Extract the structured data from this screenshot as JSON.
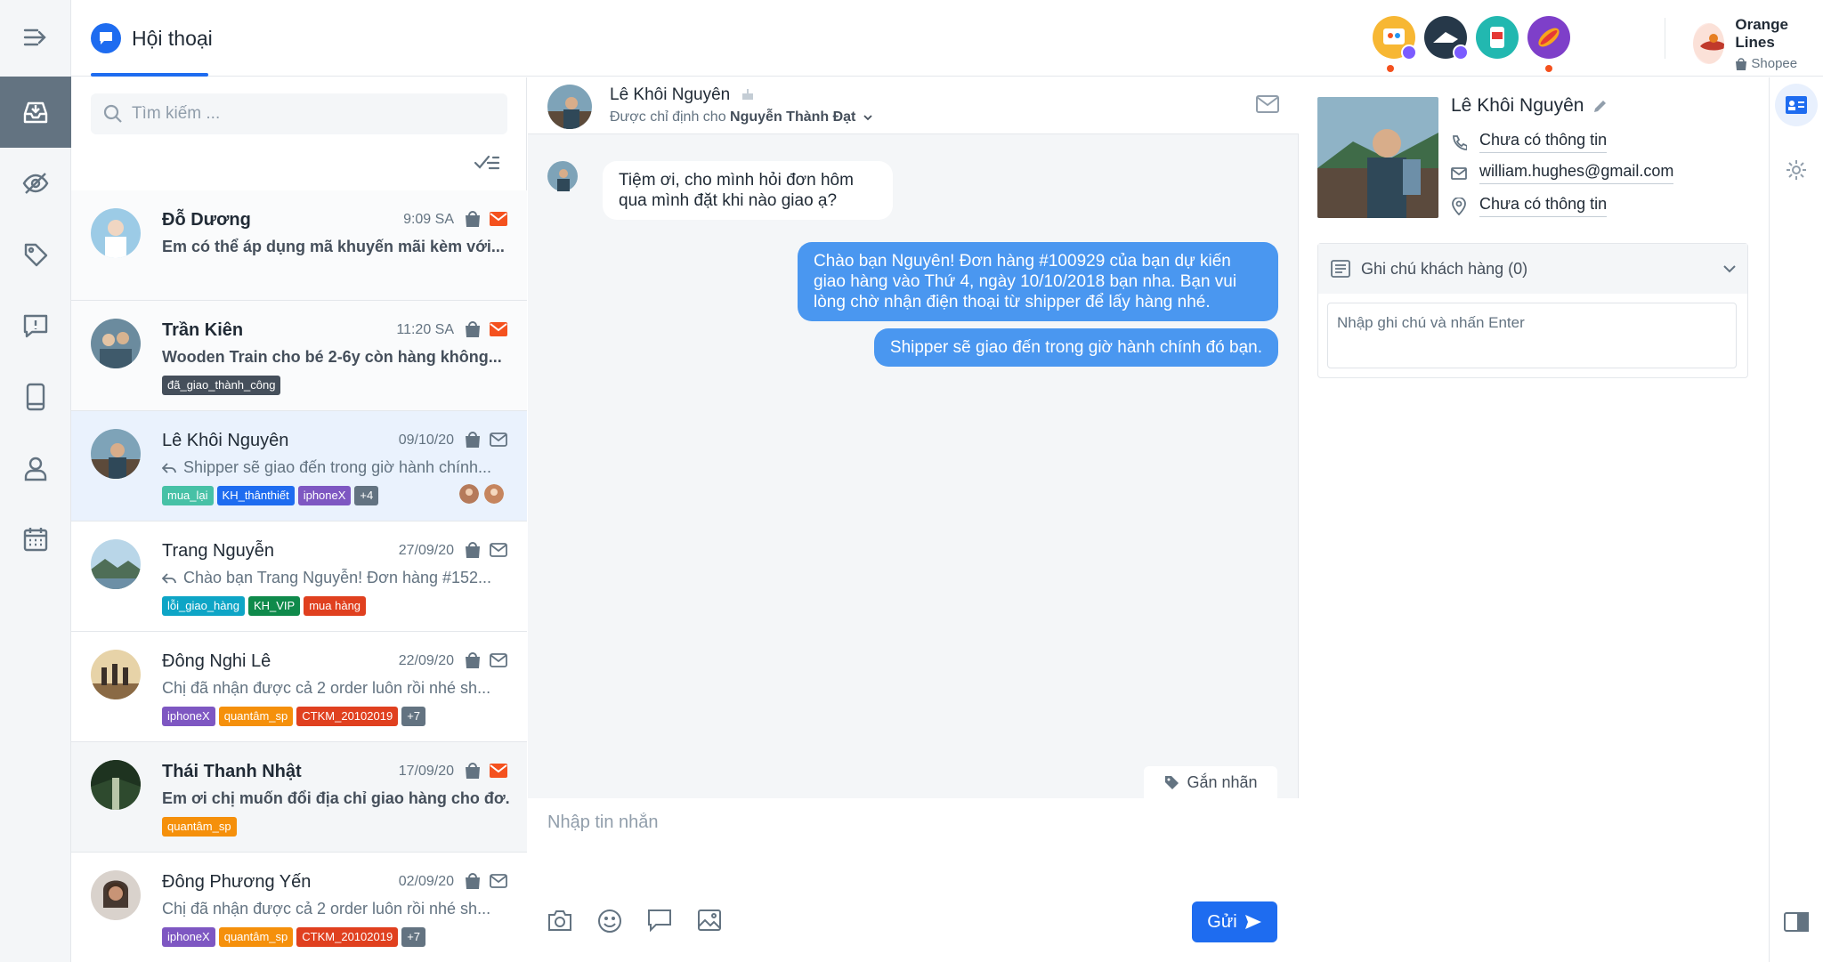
{
  "header": {
    "title": "Hội thoại"
  },
  "shop": {
    "name": "Orange Lines",
    "platform": "Shopee"
  },
  "search": {
    "placeholder": "Tìm kiếm ..."
  },
  "conversations": [
    {
      "name": "Đỗ Dương",
      "time": "9:09 SA",
      "preview": "Em có thể áp dụng mã khuyến mãi kèm với..."
    },
    {
      "name": "Trần Kiên",
      "time": "11:20 SA",
      "preview": "Wooden Train cho bé 2-6y còn hàng không...",
      "tags": [
        "đã_giao_thành_công"
      ]
    },
    {
      "name": "Lê Khôi Nguyên",
      "time": "09/10/20",
      "preview": "Shipper sẽ giao đến trong giờ hành chính...",
      "tags": [
        "mua_lại",
        "KH_thânthiết",
        "iphoneX",
        "+4"
      ]
    },
    {
      "name": "Trang Nguyễn",
      "time": "27/09/20",
      "preview": "Chào bạn Trang Nguyễn! Đơn hàng #152...",
      "tags": [
        "lỗi_giao_hàng",
        "KH_VIP",
        "mua hàng"
      ]
    },
    {
      "name": "Đông Nghi Lê",
      "time": "22/09/20",
      "preview": "Chị đã nhận được cả 2 order luôn rồi nhé sh...",
      "tags": [
        "iphoneX",
        "quantâm_sp",
        "CTKM_20102019",
        "+7"
      ]
    },
    {
      "name": "Thái Thanh Nhật",
      "time": "17/09/20",
      "preview": "Em ơi chị muốn đổi địa chỉ giao hàng cho đơ...",
      "tags": [
        "quantâm_sp"
      ]
    },
    {
      "name": "Đông Phương Yến",
      "time": "02/09/20",
      "preview": "Chị đã nhận được cả 2 order luôn rồi nhé sh...",
      "tags": [
        "iphoneX",
        "quantâm_sp",
        "CTKM_20102019",
        "+7"
      ]
    }
  ],
  "tag_colors": {
    "đã_giao_thành_công": "#454f5b",
    "mua_lại": "#47c1a6",
    "KH_thânthiết": "#1e6cf0",
    "iphoneX": "#7e57c2",
    "+4": "#637381",
    "lỗi_giao_hàng": "#0ea5c6",
    "KH_VIP": "#0f8a4b",
    "mua hàng": "#e0401f",
    "quantâm_sp": "#f5900b",
    "CTKM_20102019": "#e0401f",
    "+7": "#637381"
  },
  "chat": {
    "name": "Lê Khôi Nguyên",
    "assigned_prefix": "Được chỉ định cho",
    "assigned_to": "Nguyễn Thành Đạt",
    "messages": [
      {
        "from": "customer",
        "text": "Tiệm ơi, cho mình hỏi đơn hôm qua mình đặt khi nào giao ạ?"
      },
      {
        "from": "agent",
        "text": "Chào bạn Nguyên! Đơn hàng #100929 của bạn dự kiến giao hàng vào Thứ 4, ngày 10/10/2018 bạn nha. Bạn vui lòng chờ nhận điện thoại từ shipper để lấy hàng nhé."
      },
      {
        "from": "agent",
        "text": "Shipper sẽ giao đến trong giờ hành chính đó bạn."
      }
    ],
    "tag_button": "Gắn nhãn",
    "input_placeholder": "Nhập tin nhắn",
    "send_label": "Gửi"
  },
  "customer": {
    "name": "Lê Khôi Nguyên",
    "phone": "Chưa có thông tin",
    "email": "william.hughes@gmail.com",
    "address": "Chưa có thông tin",
    "notes_title": "Ghi chú khách hàng (0)",
    "notes_placeholder": "Nhập ghi chú và nhấn Enter"
  },
  "colors": {
    "primary": "#1e6cf0",
    "agent_bubble": "#4a97f0",
    "unread_mail": "#f4511e",
    "dot": "#f4511e"
  }
}
